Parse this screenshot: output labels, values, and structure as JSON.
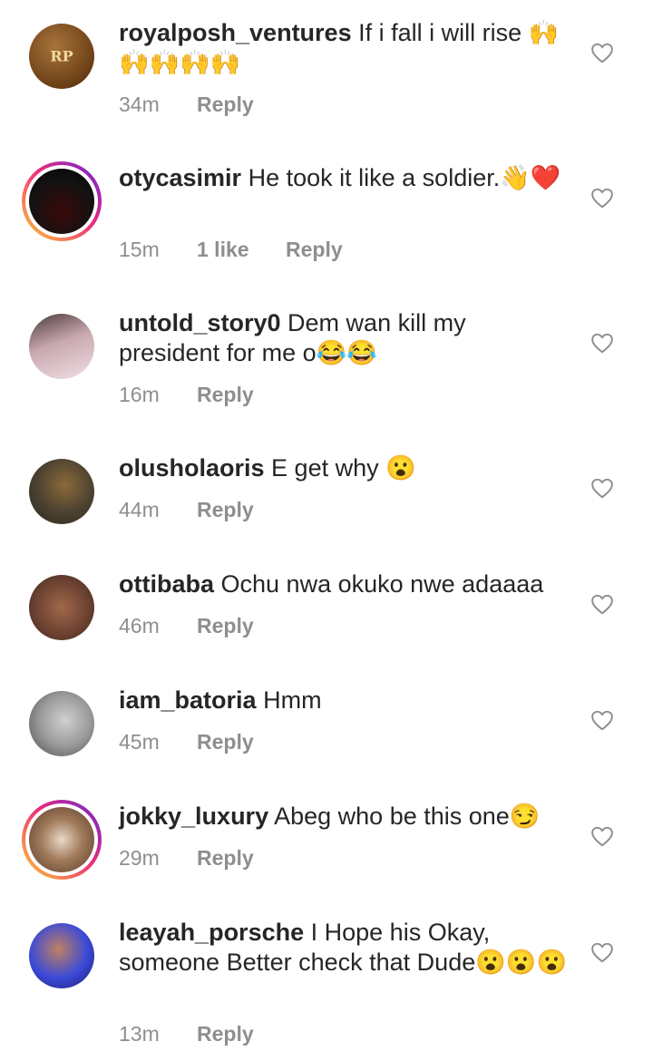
{
  "comments": [
    {
      "username": "royalposh_ventures",
      "text": "If i fall i will rise 🙌🙌🙌🙌🙌",
      "time": "34m",
      "likes": "",
      "reply": "Reply",
      "avatar_initials": "RP",
      "avatar_color": "#7a4a1e"
    },
    {
      "username": "otycasimir",
      "text": "He took it like a soldier.👋❤️",
      "time": "15m",
      "likes": "1 like",
      "reply": "Reply",
      "avatar_initials": "",
      "avatar_color": "#121212"
    },
    {
      "username": "untold_story0",
      "text": "Dem wan kill my president for me o😂😂",
      "time": "16m",
      "likes": "",
      "reply": "Reply",
      "avatar_initials": "",
      "avatar_color": "#b89aa0"
    },
    {
      "username": "olusholaoris",
      "text": "E get why 😮",
      "time": "44m",
      "likes": "",
      "reply": "Reply",
      "avatar_initials": "",
      "avatar_color": "#6b5a3a"
    },
    {
      "username": "ottibaba",
      "text": "Ochu nwa okuko nwe adaaaa",
      "time": "46m",
      "likes": "",
      "reply": "Reply",
      "avatar_initials": "",
      "avatar_color": "#6a4030"
    },
    {
      "username": "iam_batoria",
      "text": "Hmm",
      "time": "45m",
      "likes": "",
      "reply": "Reply",
      "avatar_initials": "",
      "avatar_color": "#9a9a9a"
    },
    {
      "username": "jokky_luxury",
      "text": "Abeg who be this one😏",
      "time": "29m",
      "likes": "",
      "reply": "Reply",
      "avatar_initials": "",
      "avatar_color": "#8a6a50"
    },
    {
      "username": "leayah_porsche",
      "text": "I Hope his Okay, someone Better check that Dude😮😮😮",
      "time": "13m",
      "likes": "",
      "reply": "Reply",
      "avatar_initials": "",
      "avatar_color": "#2a3cc8"
    }
  ],
  "icons": {
    "like": "heart-outline-icon"
  },
  "colors": {
    "meta": "#8e8e8e",
    "text": "#262626",
    "ring_start": "#f9ce34",
    "ring_end": "#6228d7"
  }
}
